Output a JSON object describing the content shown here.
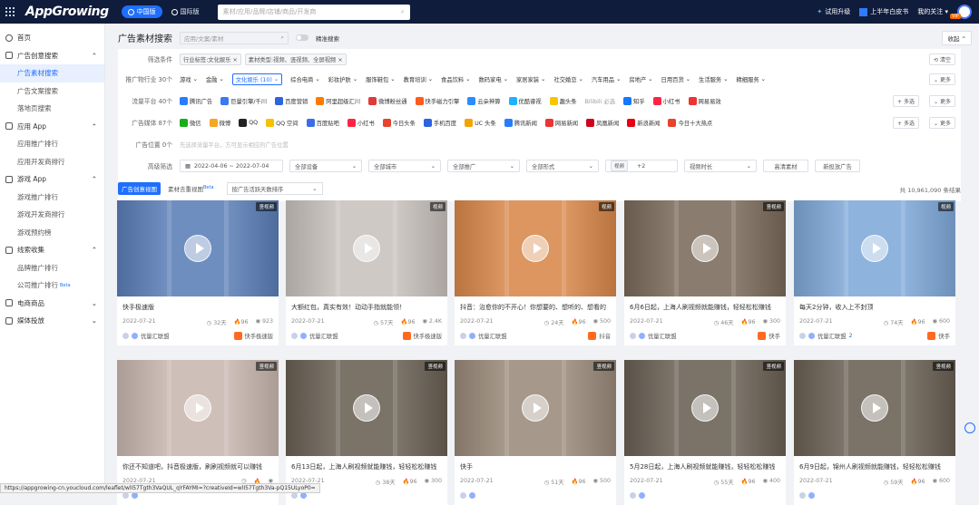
{
  "topbar": {
    "logo": "AppGrowing",
    "region_cn": "中国版",
    "region_intl": "国际版",
    "search_placeholder": "素材/应用/品牌/店铺/商品/开发商",
    "trial": "试用升级",
    "whitepaper": "上半年白皮书",
    "my_follow": "我的关注",
    "vip_badge": "VIP"
  },
  "sidebar": {
    "home": "首页",
    "groups": [
      {
        "label": "广告创意搜索",
        "items": [
          "广告素材搜索",
          "广告文案搜索",
          "落地页搜索"
        ]
      },
      {
        "label": "应用 App",
        "items": [
          "应用推广排行",
          "应用开发商排行"
        ]
      },
      {
        "label": "游戏 App",
        "items": [
          "游戏推广排行",
          "游戏开发商排行",
          "游戏预约榜"
        ]
      },
      {
        "label": "线索收集",
        "items": [
          "品牌推广排行",
          "公司推广排行"
        ]
      },
      {
        "label": "电商商品",
        "items": []
      },
      {
        "label": "媒体投放",
        "items": []
      }
    ],
    "beta": "Beta",
    "active_item": "广告素材搜索"
  },
  "header": {
    "title": "广告素材搜索",
    "input_placeholder": "应用/文案/素材",
    "exact_search": "精准搜索",
    "collapse": "收起"
  },
  "filters": {
    "conditions_label": "筛选条件",
    "condition_tags": [
      "行业标签:文化娱乐",
      "素材类型:视频、竖视频、全屏视频"
    ],
    "clear": "清空",
    "industry_label": "推广物行业 30个",
    "industry_items": [
      "游戏",
      "金融",
      "文化娱乐 (10)",
      "综合电商",
      "彩妆护肤",
      "服饰鞋包",
      "教育培训",
      "食品饮料",
      "数码家电",
      "家居家装",
      "社交婚恋",
      "汽车用品",
      "房地产",
      "日用百货",
      "生活服务",
      "精细服务"
    ],
    "more": "更多",
    "multi": "多选",
    "traffic_label": "流量平台 40个",
    "traffic_items": [
      "腾讯广告",
      "巨量引擎/千川",
      "百度营销",
      "阿里超级汇川",
      "微博粉丝通",
      "快手磁力引擎",
      "云朵神算",
      "优酷睿视",
      "趣头条",
      "Bilibili 必选",
      "知乎",
      "小红书",
      "网易易效"
    ],
    "media_label": "广告媒体 87个",
    "media_items": [
      "微信",
      "微博",
      "QQ",
      "QQ 空间",
      "百度贴吧",
      "小红书",
      "今日头条",
      "手机百度",
      "UC 头条",
      "腾讯新闻",
      "网易新闻",
      "凤凰新闻",
      "新浪新闻",
      "今日十大热点"
    ],
    "position_label": "广告位置 0个",
    "position_hint": "先选择流量平台，方可显示相应的广告位置",
    "advanced_label": "高级筛选",
    "date_range": "2022-04-06 ~ 2022-07-04",
    "device": "全部设备",
    "city": "全部城市",
    "promotion": "全部推广",
    "format": "全部形式",
    "video_tag": "视频",
    "video_plus": "+2",
    "duration": "视频时长",
    "hq": "高清素材",
    "new_ads": "新投放广告"
  },
  "tabs": {
    "creative": "广告创意视图",
    "material": "素材去重视图",
    "beta": "Beta",
    "sort": "按广告活跃天数排序",
    "total": "共 10,961,090 条结果"
  },
  "cards": [
    {
      "title": "快手极速版",
      "date": "2022-07-21",
      "days": "32天",
      "fire": "96",
      "views": "923",
      "source": "优量汇联盟",
      "app": "快手极速版",
      "badge": "竖视频",
      "theme": "#5b7fb8"
    },
    {
      "title": "大额红包，真实有效！动动手指就能领！",
      "date": "2022-07-21",
      "days": "57天",
      "fire": "96",
      "views": "2.4K",
      "source": "优量汇联盟",
      "app": "快手极速版",
      "badge": "视频",
      "theme": "#c9c2be"
    },
    {
      "title": "抖音：治愈你的不开心！你想要的、想听的、想看的",
      "date": "2022-07-21",
      "days": "24天",
      "fire": "96",
      "views": "500",
      "source": "优量汇联盟",
      "app": "抖音",
      "badge": "视频",
      "theme": "#d9884a"
    },
    {
      "title": "6月6日起，上海人刷视频就能赚钱，轻轻松松赚钱",
      "date": "2022-07-21",
      "days": "46天",
      "fire": "96",
      "views": "300",
      "source": "优量汇联盟",
      "app": "快手",
      "badge": "竖视频",
      "theme": "#7a6a5a"
    },
    {
      "title": "每天2分钟，收入上不封顶",
      "date": "2022-07-21",
      "days": "74天",
      "fire": "96",
      "views": "600",
      "source": "优量汇联盟",
      "app": "快手",
      "badge": "视频",
      "theme": "#7fa9d9",
      "extra": "2"
    },
    {
      "title": "你还不知道吧，抖音极速版，刷刷视频就可以赚钱",
      "date": "2022-07-21",
      "days": "",
      "fire": "",
      "views": "",
      "source": "",
      "app": "",
      "badge": "竖视频",
      "theme": "#c9b7b0"
    },
    {
      "title": "6月13日起，上海人刷视频就能赚钱，轻轻松松赚钱",
      "date": "2022-07-21",
      "days": "38天",
      "fire": "96",
      "views": "300",
      "source": "",
      "app": "",
      "badge": "竖视频",
      "theme": "#6a6054"
    },
    {
      "title": "快手",
      "date": "2022-07-21",
      "days": "51天",
      "fire": "96",
      "views": "500",
      "source": "",
      "app": "",
      "badge": "竖视频",
      "theme": "#9a8a7a"
    },
    {
      "title": "5月28日起，上海人刷视频就能赚钱，轻轻松松赚钱",
      "date": "2022-07-21",
      "days": "55天",
      "fire": "96",
      "views": "400",
      "source": "",
      "app": "",
      "badge": "竖视频",
      "theme": "#6a6054"
    },
    {
      "title": "6月9日起，锦州人刷视频就能赚钱，轻轻松松赚钱",
      "date": "2022-07-21",
      "days": "59天",
      "fire": "96",
      "views": "600",
      "source": "",
      "app": "",
      "badge": "竖视频",
      "theme": "#6a6054"
    }
  ],
  "statusbar": "https://appgrowing-cn.youcloud.com/leaflet/wlI57Tgth3VaQUL_qYFAYMI=?creativeId=wlI57Tgth3Va-pQ15ULyoP0="
}
